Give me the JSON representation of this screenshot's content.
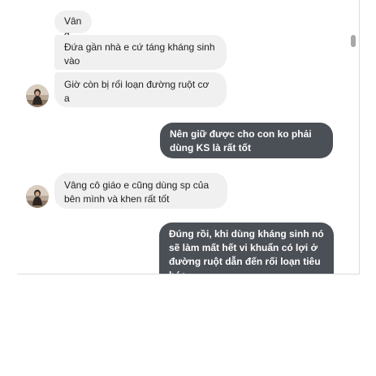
{
  "conversation": {
    "messages": [
      {
        "id": "m1",
        "direction": "incoming",
        "text": "Vâng"
      },
      {
        "id": "m2",
        "direction": "incoming",
        "text": "Đứa gần nhà e cứ táng kháng sinh vào"
      },
      {
        "id": "m3",
        "direction": "incoming",
        "text": "Giờ còn bị rối loạn đường ruột cơ a"
      },
      {
        "id": "m4",
        "direction": "outgoing",
        "text": "Nên giữ được cho con ko phải dùng KS là rất tốt"
      },
      {
        "id": "m5",
        "direction": "incoming",
        "text": "Vâng cô giáo e cũng dùng sp của bên mình và khen rất tốt"
      },
      {
        "id": "m6",
        "direction": "outgoing",
        "text": "Đúng rồi, khi dùng kháng sinh nó sẽ làm mất hết vi khuẩn có lợi ở đường ruột dẫn đến rối loạn tiêu hóa"
      }
    ]
  },
  "colors": {
    "incoming_bubble": "#f1f0f0",
    "outgoing_bubble": "#4b4f56",
    "outgoing_text": "#ffffff"
  }
}
